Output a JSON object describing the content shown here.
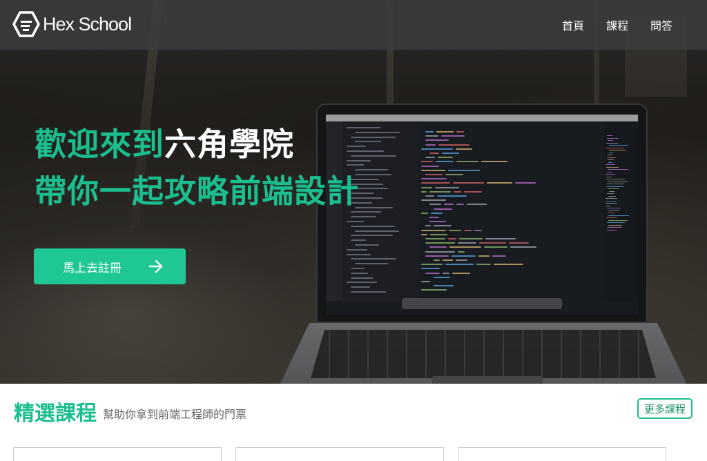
{
  "navbar": {
    "brand": "Hex School",
    "links": [
      {
        "label": "首頁"
      },
      {
        "label": "課程"
      },
      {
        "label": "問答"
      }
    ]
  },
  "hero": {
    "line1_green": "歡迎來到",
    "line1_white": "六角學院",
    "line2": "帶你一起攻略前端設計",
    "cta_label": "馬上去註冊"
  },
  "courses_section": {
    "title": "精選課程",
    "subtitle": "幫助你拿到前端工程師的門票",
    "more_label": "更多課程"
  },
  "colors": {
    "accent": "#1ec793",
    "accent_text": "#1bbf8f",
    "navbar_bg": "#3c3c3c"
  },
  "icons": {
    "logo": "hexagon-logo-icon",
    "cta": "arrow-right-icon"
  }
}
